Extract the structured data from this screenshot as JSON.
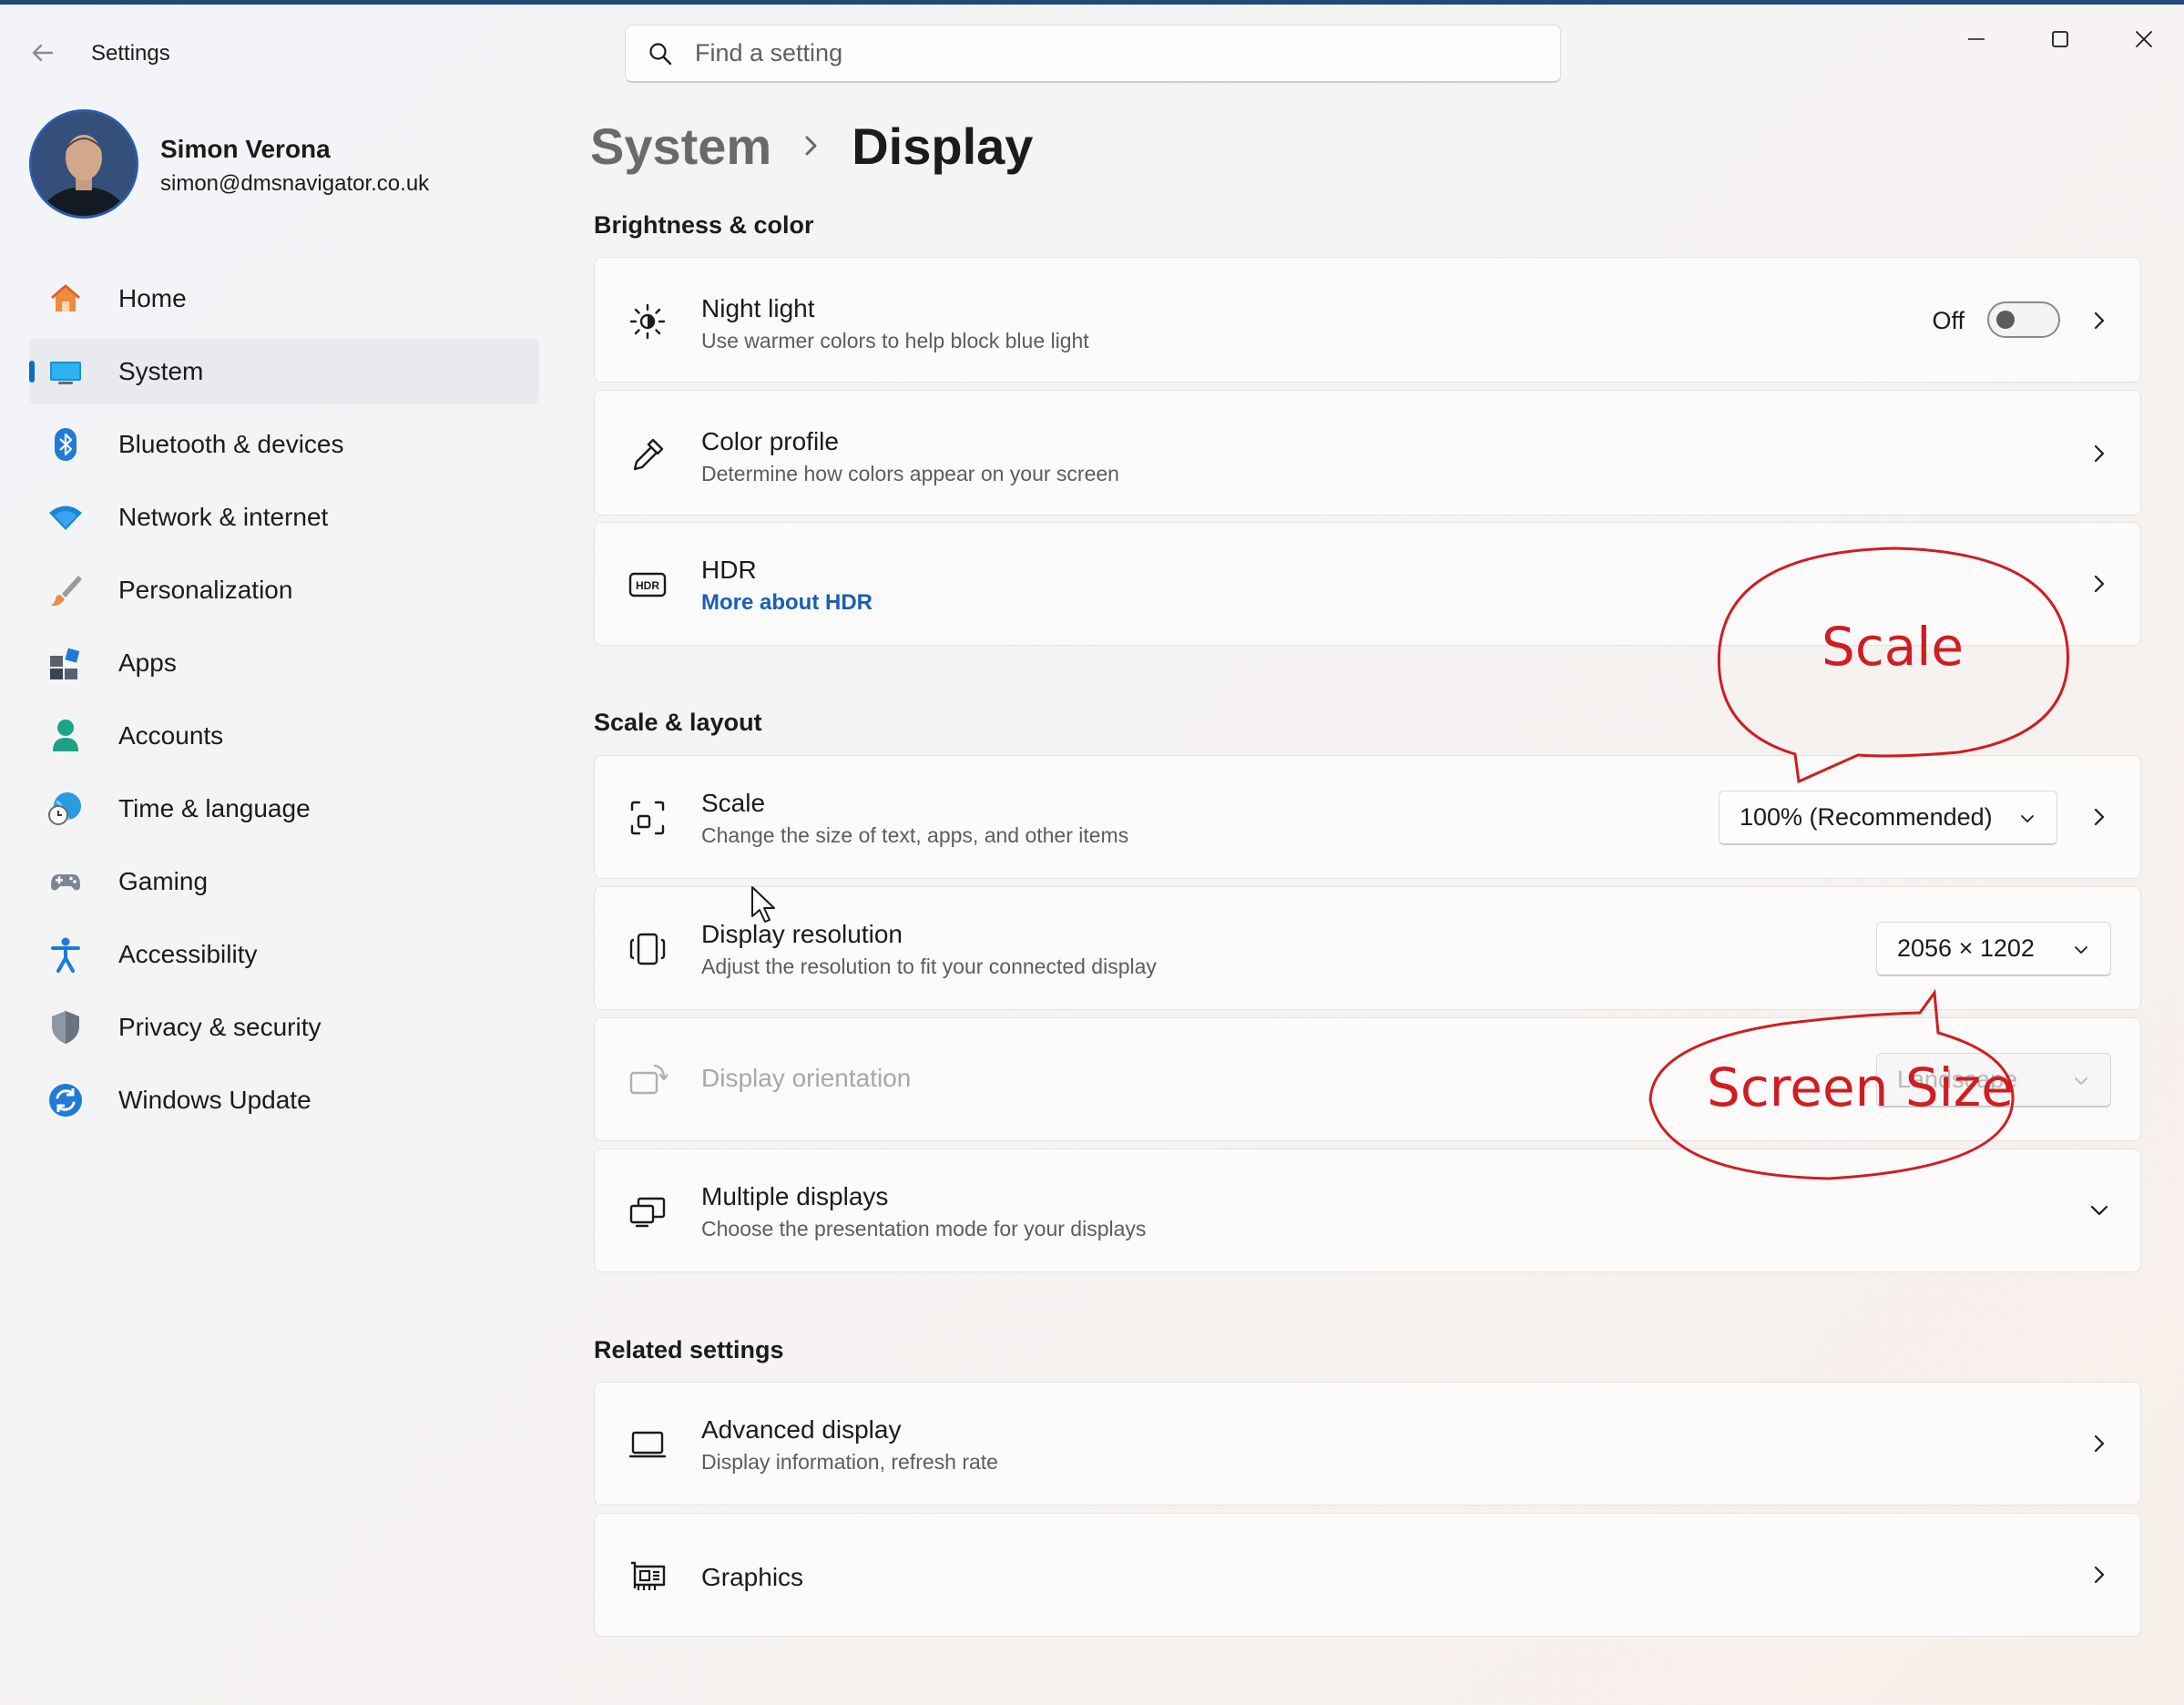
{
  "window": {
    "app_title": "Settings",
    "search_placeholder": "Find a setting"
  },
  "profile": {
    "name": "Simon Verona",
    "email": "simon@dmsnavigator.co.uk"
  },
  "nav": {
    "items": [
      {
        "label": "Home",
        "icon": "home-icon",
        "active": false
      },
      {
        "label": "System",
        "icon": "system-icon",
        "active": true
      },
      {
        "label": "Bluetooth & devices",
        "icon": "bluetooth-icon",
        "active": false
      },
      {
        "label": "Network & internet",
        "icon": "wifi-icon",
        "active": false
      },
      {
        "label": "Personalization",
        "icon": "brush-icon",
        "active": false
      },
      {
        "label": "Apps",
        "icon": "apps-icon",
        "active": false
      },
      {
        "label": "Accounts",
        "icon": "person-icon",
        "active": false
      },
      {
        "label": "Time & language",
        "icon": "globe-clock-icon",
        "active": false
      },
      {
        "label": "Gaming",
        "icon": "gamepad-icon",
        "active": false
      },
      {
        "label": "Accessibility",
        "icon": "accessibility-icon",
        "active": false
      },
      {
        "label": "Privacy & security",
        "icon": "shield-icon",
        "active": false
      },
      {
        "label": "Windows Update",
        "icon": "update-icon",
        "active": false
      }
    ]
  },
  "breadcrumb": {
    "parent": "System",
    "current": "Display"
  },
  "sections": {
    "brightness": "Brightness & color",
    "scale_layout": "Scale & layout",
    "related": "Related settings"
  },
  "settings": {
    "night_light": {
      "title": "Night light",
      "subtitle": "Use warmer colors to help block blue light",
      "state_label": "Off",
      "on": false
    },
    "color_profile": {
      "title": "Color profile",
      "subtitle": "Determine how colors appear on your screen"
    },
    "hdr": {
      "title": "HDR",
      "link": "More about HDR"
    },
    "scale": {
      "title": "Scale",
      "subtitle": "Change the size of text, apps, and other items",
      "value": "100% (Recommended)"
    },
    "resolution": {
      "title": "Display resolution",
      "subtitle": "Adjust the resolution to fit your connected display",
      "value": "2056 × 1202"
    },
    "orientation": {
      "title": "Display orientation",
      "value": "Landscape",
      "disabled": true
    },
    "multiple": {
      "title": "Multiple displays",
      "subtitle": "Choose the presentation mode for your displays"
    },
    "advanced": {
      "title": "Advanced display",
      "subtitle": "Display information, refresh rate"
    },
    "graphics": {
      "title": "Graphics"
    }
  },
  "annotations": {
    "scale_callout": "Scale",
    "screen_size_callout": "Screen Size",
    "color": "#cf1d22"
  },
  "colors": {
    "accent": "#0f6cbd",
    "link": "#1a5fb4"
  }
}
